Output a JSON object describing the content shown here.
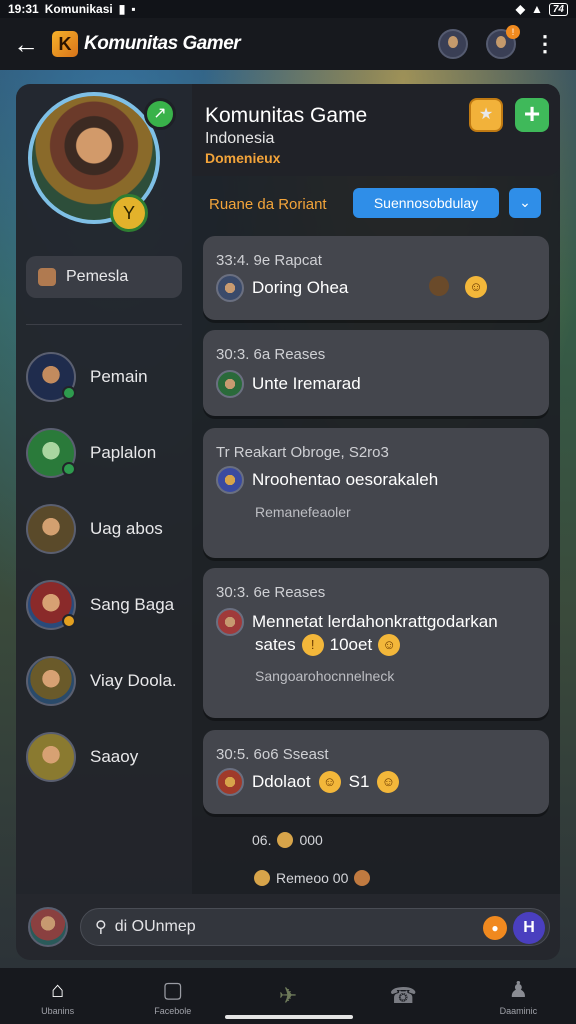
{
  "status_bar": {
    "time": "19:31",
    "carrier": "Komunikasi",
    "battery": "74"
  },
  "app_bar": {
    "back_icon": "arrow-left-icon",
    "title": "Komunitas Gamer"
  },
  "sidebar": {
    "chip_label": "Pemesla",
    "members": [
      {
        "name": "Pemain",
        "dot": "#2e9b4e"
      },
      {
        "name": "Paplalon",
        "dot": "#2e9b4e"
      },
      {
        "name": "Uag abos",
        "dot": ""
      },
      {
        "name": "Sang Baga",
        "dot": "#e3a020"
      },
      {
        "name": "Viay Doola.",
        "dot": ""
      },
      {
        "name": "Saaoy",
        "dot": ""
      }
    ]
  },
  "group": {
    "title": "Komunitas Game",
    "subtitle": "Indonesia",
    "tag": "Domenieux",
    "link": "Ruane da Roriant",
    "pill": "Suennosobdulay"
  },
  "posts": [
    {
      "meta": "33:4. 9e Rapcat",
      "text": "Doring Ohea",
      "sub": ""
    },
    {
      "meta": "30:3. 6a Reases",
      "text": "Unte Iremarad",
      "sub": ""
    },
    {
      "meta": "Tr  Reakart Obroge, S2ro3",
      "text": "Nroohentao oesorakaleh",
      "sub": "Remanefeaoler"
    },
    {
      "meta": "30:3. 6e Reases",
      "text": "Mennetat lerdahonkrattgodarkan",
      "text2": "sates",
      "text3": "10oet",
      "sub": "Sangoarohocnnelneck"
    },
    {
      "meta": "30:5. 6o6 Sseast",
      "text": "Ddolaot",
      "text2": "S1",
      "sub": ""
    }
  ],
  "mini_rows": [
    {
      "text": "06.",
      "text2": "000"
    },
    {
      "text": "Remeoo 00"
    }
  ],
  "composer": {
    "placeholder": "di OUnmep"
  },
  "bottom_nav": [
    {
      "label": "Ubanins",
      "icon": "home-icon"
    },
    {
      "label": "Facebole",
      "icon": "square-icon"
    },
    {
      "label": "",
      "icon": "controller-icon"
    },
    {
      "label": "",
      "icon": "headset-icon"
    },
    {
      "label": "Daaminic",
      "icon": "profile-icon"
    }
  ]
}
